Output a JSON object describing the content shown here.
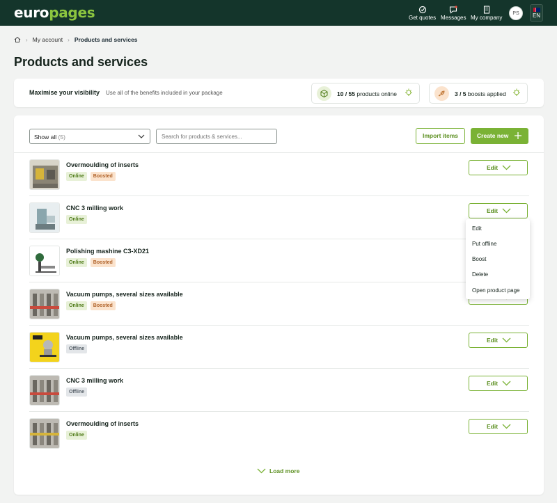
{
  "header": {
    "logo": {
      "part1": "euro",
      "part2": "pages"
    },
    "nav": [
      {
        "label": "Get quotes",
        "icon": "quote-icon"
      },
      {
        "label": "Messages",
        "icon": "messages-icon"
      },
      {
        "label": "My company",
        "icon": "company-icon"
      }
    ],
    "avatar_initials": "PS",
    "language": "EN"
  },
  "breadcrumb": {
    "home_icon": "home-icon",
    "items": [
      "My account",
      "Products and services"
    ]
  },
  "page_title": "Products and services",
  "visibility": {
    "title": "Maximise your visibility",
    "subtitle": "Use all of the benefits included in your package",
    "products_stat": {
      "count": "10 / 55",
      "label": "products online"
    },
    "boosts_stat": {
      "count": "3 / 5",
      "label": "boosts applied"
    }
  },
  "toolbar": {
    "filter_label": "Show all",
    "filter_count": "(5)",
    "search_placeholder": "Search for products & services...",
    "import_label": "Import items",
    "create_label": "Create new"
  },
  "products": [
    {
      "name": "Overmoulding of inserts",
      "badges": [
        "Online",
        "Boosted"
      ],
      "edit": "Edit"
    },
    {
      "name": "CNC 3 milling work",
      "badges": [
        "Online"
      ],
      "edit": "Edit"
    },
    {
      "name": "Polishing mashine C3-XD21",
      "badges": [
        "Online",
        "Boosted"
      ],
      "edit": "Edit"
    },
    {
      "name": "Vacuum pumps, several sizes available",
      "badges": [
        "Online",
        "Boosted"
      ],
      "edit": "Edit"
    },
    {
      "name": "Vacuum pumps, several sizes available",
      "badges": [
        "Offline"
      ],
      "edit": "Edit"
    },
    {
      "name": "CNC 3 milling work",
      "badges": [
        "Offline"
      ],
      "edit": "Edit"
    },
    {
      "name": "Overmoulding of inserts",
      "badges": [
        "Online"
      ],
      "edit": "Edit"
    }
  ],
  "dropdown": {
    "items": [
      "Edit",
      "Put offline",
      "Boost",
      "Delete",
      "Open product page"
    ]
  },
  "load_more": "Load more",
  "colors": {
    "brand_dark": "#14352b",
    "accent": "#7ab235",
    "online": "#4d7a16",
    "boosted": "#b0632a"
  }
}
